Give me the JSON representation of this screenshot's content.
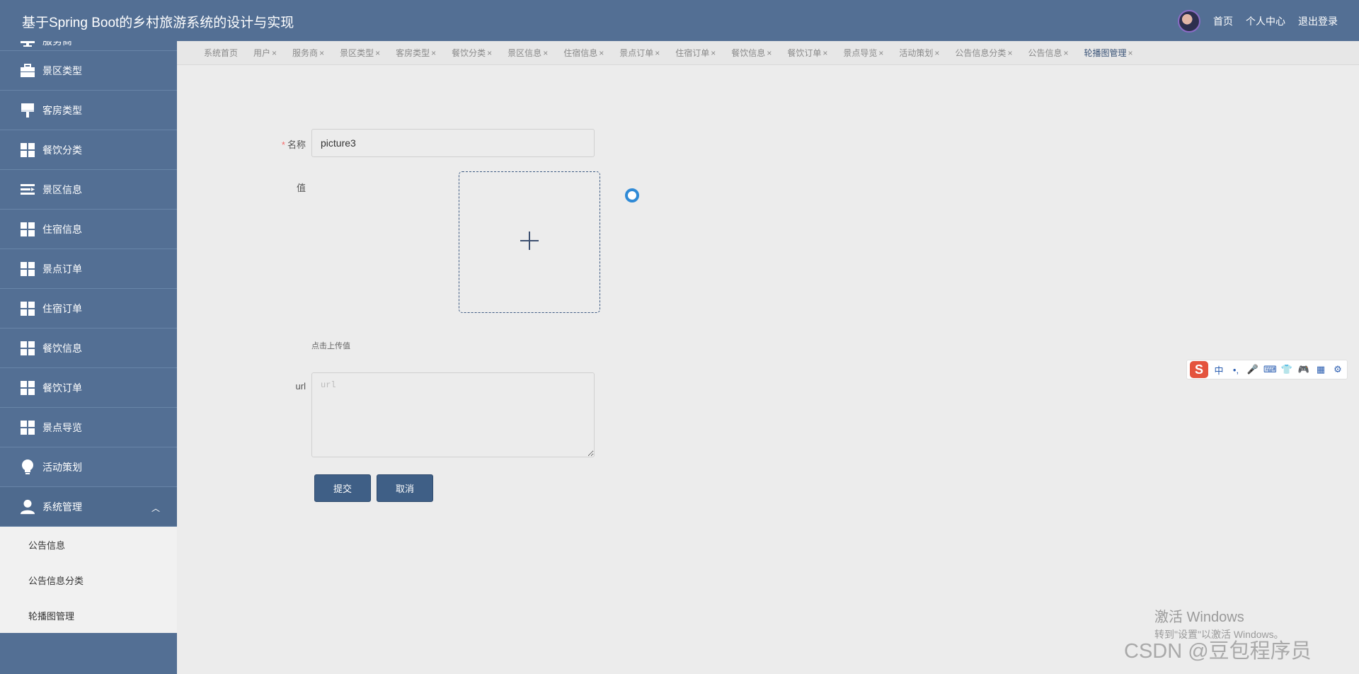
{
  "header": {
    "title": "基于Spring Boot的乡村旅游系统的设计与实现",
    "links": [
      "首页",
      "个人中心",
      "退出登录"
    ]
  },
  "sidebar": {
    "items": [
      {
        "label": "服务商",
        "icon": "monitor-icon"
      },
      {
        "label": "景区类型",
        "icon": "briefcase-icon"
      },
      {
        "label": "客房类型",
        "icon": "brush-icon"
      },
      {
        "label": "餐饮分类",
        "icon": "grid-icon"
      },
      {
        "label": "景区信息",
        "icon": "list-icon"
      },
      {
        "label": "住宿信息",
        "icon": "grid-icon"
      },
      {
        "label": "景点订单",
        "icon": "grid-icon"
      },
      {
        "label": "住宿订单",
        "icon": "grid-icon"
      },
      {
        "label": "餐饮信息",
        "icon": "grid-icon"
      },
      {
        "label": "餐饮订单",
        "icon": "grid-icon"
      },
      {
        "label": "景点导览",
        "icon": "grid-icon"
      },
      {
        "label": "活动策划",
        "icon": "bulb-icon"
      },
      {
        "label": "系统管理",
        "icon": "user-icon"
      }
    ],
    "submenu": [
      "公告信息",
      "公告信息分类",
      "轮播图管理"
    ]
  },
  "tabs": [
    {
      "label": "系统首页",
      "closable": false
    },
    {
      "label": "用户",
      "closable": true
    },
    {
      "label": "服务商",
      "closable": true
    },
    {
      "label": "景区类型",
      "closable": true
    },
    {
      "label": "客房类型",
      "closable": true
    },
    {
      "label": "餐饮分类",
      "closable": true
    },
    {
      "label": "景区信息",
      "closable": true
    },
    {
      "label": "住宿信息",
      "closable": true
    },
    {
      "label": "景点订单",
      "closable": true
    },
    {
      "label": "住宿订单",
      "closable": true
    },
    {
      "label": "餐饮信息",
      "closable": true
    },
    {
      "label": "餐饮订单",
      "closable": true
    },
    {
      "label": "景点导览",
      "closable": true
    },
    {
      "label": "活动策划",
      "closable": true
    },
    {
      "label": "公告信息分类",
      "closable": true
    },
    {
      "label": "公告信息",
      "closable": true
    },
    {
      "label": "轮播图管理",
      "closable": true,
      "active": true
    }
  ],
  "tab_close_glyph": "×",
  "form": {
    "name_label": "名称",
    "required_mark": "*",
    "name_value": "picture3",
    "value_label": "值",
    "upload_hint": "点击上传值",
    "url_label": "url",
    "url_placeholder": "url",
    "submit_label": "提交",
    "cancel_label": "取消"
  },
  "ime": {
    "logo": "S",
    "items": [
      "中",
      "•,",
      "🎤",
      "⌨",
      "👕",
      "🎮",
      "▦",
      "⚙"
    ]
  },
  "watermark": {
    "title": "激活 Windows",
    "subtitle": "转到\"设置\"以激活 Windows。",
    "csdn": "CSDN @豆包程序员"
  },
  "colors": {
    "header": "#536f94",
    "primary_button": "#3f5f86",
    "required": "#f56c6c"
  }
}
